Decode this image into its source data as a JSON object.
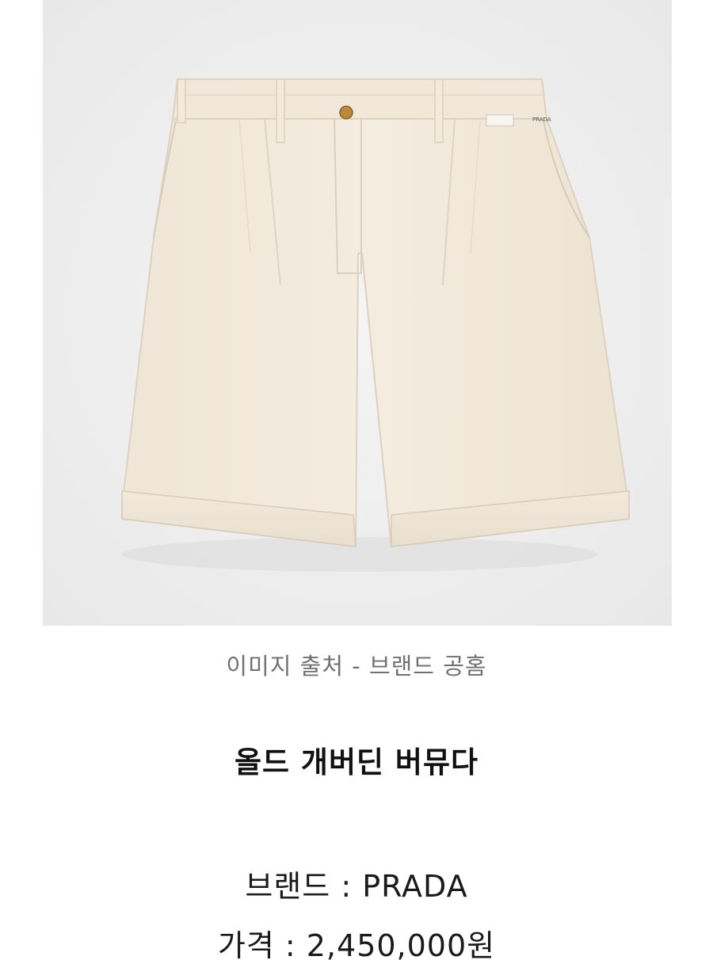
{
  "image": {
    "alt_icon": "product-photo-bermuda-shorts",
    "colors": {
      "background": "#eeeeee",
      "fabric": "#f1e9dc",
      "fabric_shadow": "#e2d7c6",
      "button": "#b88a3a"
    },
    "label_tag_text": "PRADA"
  },
  "caption": "이미지 출처 - 브랜드 공홈",
  "product": {
    "name": "올드 개버딘 버뮤다",
    "brand_line": "브랜드 : PRADA",
    "price_line": "가격 : 2,450,000원"
  }
}
